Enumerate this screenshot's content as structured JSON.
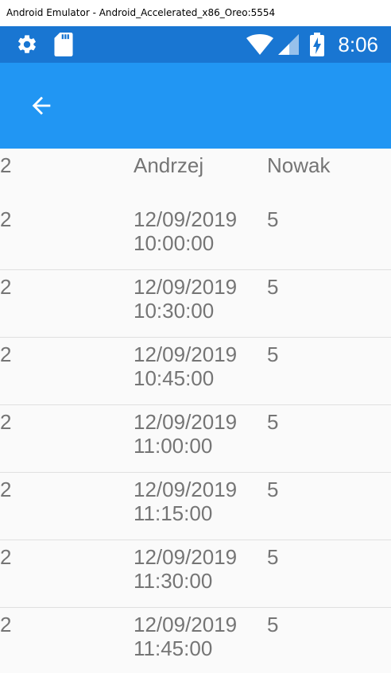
{
  "window": {
    "title": "Android Emulator - Android_Accelerated_x86_Oreo:5554"
  },
  "status_bar": {
    "time": "8:06",
    "icons": [
      "gear-icon",
      "sd-card-icon",
      "wifi-icon",
      "signal-icon",
      "battery-charging-icon"
    ],
    "background": "#1976d2"
  },
  "app_bar": {
    "background": "#2196f3",
    "back_icon": "arrow-back-icon"
  },
  "list": {
    "header": {
      "col1": "2",
      "col2": "Andrzej",
      "col3": "Nowak"
    },
    "rows": [
      {
        "col1": "2",
        "date": "12/09/2019",
        "time": "10:00:00",
        "col3": "5"
      },
      {
        "col1": "2",
        "date": "12/09/2019",
        "time": "10:30:00",
        "col3": "5"
      },
      {
        "col1": "2",
        "date": "12/09/2019",
        "time": "10:45:00",
        "col3": "5"
      },
      {
        "col1": "2",
        "date": "12/09/2019",
        "time": "11:00:00",
        "col3": "5"
      },
      {
        "col1": "2",
        "date": "12/09/2019",
        "time": "11:15:00",
        "col3": "5"
      },
      {
        "col1": "2",
        "date": "12/09/2019",
        "time": "11:30:00",
        "col3": "5"
      },
      {
        "col1": "2",
        "date": "12/09/2019",
        "time": "11:45:00",
        "col3": "5"
      }
    ]
  }
}
